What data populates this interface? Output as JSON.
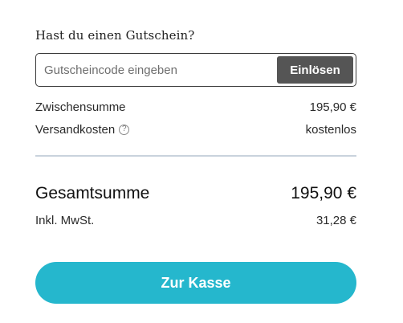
{
  "voucher": {
    "title": "Hast du einen Gutschein?",
    "input_placeholder": "Gutscheincode eingeben",
    "input_value": "",
    "redeem_label": "Einlösen"
  },
  "summary": {
    "subtotal_label": "Zwischensumme",
    "subtotal_value": "195,90 €",
    "shipping_label": "Versandkosten",
    "shipping_info_icon": "question-icon",
    "shipping_value": "kostenlos",
    "total_label": "Gesamtsumme",
    "total_value": "195,90 €",
    "vat_label": "Inkl. MwSt.",
    "vat_value": "31,28 €"
  },
  "checkout": {
    "button_label": "Zur Kasse"
  },
  "colors": {
    "accent": "#25b7cd",
    "redeem_button": "#555555",
    "divider": "#c9d3dd"
  }
}
